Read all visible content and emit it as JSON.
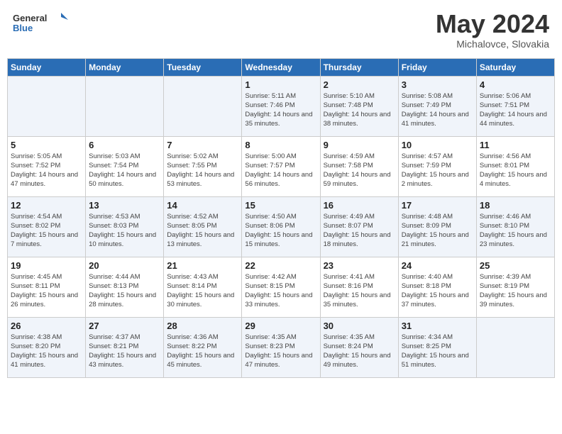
{
  "header": {
    "logo_line1": "General",
    "logo_line2": "Blue",
    "month_year": "May 2024",
    "location": "Michalovce, Slovakia"
  },
  "days_of_week": [
    "Sunday",
    "Monday",
    "Tuesday",
    "Wednesday",
    "Thursday",
    "Friday",
    "Saturday"
  ],
  "weeks": [
    [
      {
        "day": "",
        "info": ""
      },
      {
        "day": "",
        "info": ""
      },
      {
        "day": "",
        "info": ""
      },
      {
        "day": "1",
        "info": "Sunrise: 5:11 AM\nSunset: 7:46 PM\nDaylight: 14 hours\nand 35 minutes."
      },
      {
        "day": "2",
        "info": "Sunrise: 5:10 AM\nSunset: 7:48 PM\nDaylight: 14 hours\nand 38 minutes."
      },
      {
        "day": "3",
        "info": "Sunrise: 5:08 AM\nSunset: 7:49 PM\nDaylight: 14 hours\nand 41 minutes."
      },
      {
        "day": "4",
        "info": "Sunrise: 5:06 AM\nSunset: 7:51 PM\nDaylight: 14 hours\nand 44 minutes."
      }
    ],
    [
      {
        "day": "5",
        "info": "Sunrise: 5:05 AM\nSunset: 7:52 PM\nDaylight: 14 hours\nand 47 minutes."
      },
      {
        "day": "6",
        "info": "Sunrise: 5:03 AM\nSunset: 7:54 PM\nDaylight: 14 hours\nand 50 minutes."
      },
      {
        "day": "7",
        "info": "Sunrise: 5:02 AM\nSunset: 7:55 PM\nDaylight: 14 hours\nand 53 minutes."
      },
      {
        "day": "8",
        "info": "Sunrise: 5:00 AM\nSunset: 7:57 PM\nDaylight: 14 hours\nand 56 minutes."
      },
      {
        "day": "9",
        "info": "Sunrise: 4:59 AM\nSunset: 7:58 PM\nDaylight: 14 hours\nand 59 minutes."
      },
      {
        "day": "10",
        "info": "Sunrise: 4:57 AM\nSunset: 7:59 PM\nDaylight: 15 hours\nand 2 minutes."
      },
      {
        "day": "11",
        "info": "Sunrise: 4:56 AM\nSunset: 8:01 PM\nDaylight: 15 hours\nand 4 minutes."
      }
    ],
    [
      {
        "day": "12",
        "info": "Sunrise: 4:54 AM\nSunset: 8:02 PM\nDaylight: 15 hours\nand 7 minutes."
      },
      {
        "day": "13",
        "info": "Sunrise: 4:53 AM\nSunset: 8:03 PM\nDaylight: 15 hours\nand 10 minutes."
      },
      {
        "day": "14",
        "info": "Sunrise: 4:52 AM\nSunset: 8:05 PM\nDaylight: 15 hours\nand 13 minutes."
      },
      {
        "day": "15",
        "info": "Sunrise: 4:50 AM\nSunset: 8:06 PM\nDaylight: 15 hours\nand 15 minutes."
      },
      {
        "day": "16",
        "info": "Sunrise: 4:49 AM\nSunset: 8:07 PM\nDaylight: 15 hours\nand 18 minutes."
      },
      {
        "day": "17",
        "info": "Sunrise: 4:48 AM\nSunset: 8:09 PM\nDaylight: 15 hours\nand 21 minutes."
      },
      {
        "day": "18",
        "info": "Sunrise: 4:46 AM\nSunset: 8:10 PM\nDaylight: 15 hours\nand 23 minutes."
      }
    ],
    [
      {
        "day": "19",
        "info": "Sunrise: 4:45 AM\nSunset: 8:11 PM\nDaylight: 15 hours\nand 26 minutes."
      },
      {
        "day": "20",
        "info": "Sunrise: 4:44 AM\nSunset: 8:13 PM\nDaylight: 15 hours\nand 28 minutes."
      },
      {
        "day": "21",
        "info": "Sunrise: 4:43 AM\nSunset: 8:14 PM\nDaylight: 15 hours\nand 30 minutes."
      },
      {
        "day": "22",
        "info": "Sunrise: 4:42 AM\nSunset: 8:15 PM\nDaylight: 15 hours\nand 33 minutes."
      },
      {
        "day": "23",
        "info": "Sunrise: 4:41 AM\nSunset: 8:16 PM\nDaylight: 15 hours\nand 35 minutes."
      },
      {
        "day": "24",
        "info": "Sunrise: 4:40 AM\nSunset: 8:18 PM\nDaylight: 15 hours\nand 37 minutes."
      },
      {
        "day": "25",
        "info": "Sunrise: 4:39 AM\nSunset: 8:19 PM\nDaylight: 15 hours\nand 39 minutes."
      }
    ],
    [
      {
        "day": "26",
        "info": "Sunrise: 4:38 AM\nSunset: 8:20 PM\nDaylight: 15 hours\nand 41 minutes."
      },
      {
        "day": "27",
        "info": "Sunrise: 4:37 AM\nSunset: 8:21 PM\nDaylight: 15 hours\nand 43 minutes."
      },
      {
        "day": "28",
        "info": "Sunrise: 4:36 AM\nSunset: 8:22 PM\nDaylight: 15 hours\nand 45 minutes."
      },
      {
        "day": "29",
        "info": "Sunrise: 4:35 AM\nSunset: 8:23 PM\nDaylight: 15 hours\nand 47 minutes."
      },
      {
        "day": "30",
        "info": "Sunrise: 4:35 AM\nSunset: 8:24 PM\nDaylight: 15 hours\nand 49 minutes."
      },
      {
        "day": "31",
        "info": "Sunrise: 4:34 AM\nSunset: 8:25 PM\nDaylight: 15 hours\nand 51 minutes."
      },
      {
        "day": "",
        "info": ""
      }
    ]
  ]
}
